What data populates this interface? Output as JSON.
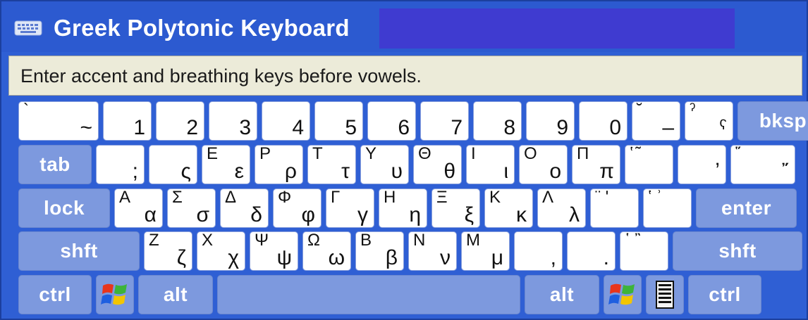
{
  "window": {
    "title": "Greek Polytonic Keyboard",
    "title_icon": "keyboard-icon"
  },
  "status": {
    "text": "Enter accent and breathing keys before vowels."
  },
  "rows": [
    [
      {
        "name": "key-grave",
        "type": "char",
        "up": "`",
        "lo": "~",
        "w": 114
      },
      {
        "name": "key-1",
        "type": "char",
        "up": "",
        "lo": "1",
        "w": 69
      },
      {
        "name": "key-2",
        "type": "char",
        "up": "",
        "lo": "2",
        "w": 69
      },
      {
        "name": "key-3",
        "type": "char",
        "up": "",
        "lo": "3",
        "w": 69
      },
      {
        "name": "key-4",
        "type": "char",
        "up": "",
        "lo": "4",
        "w": 69
      },
      {
        "name": "key-5",
        "type": "char",
        "up": "",
        "lo": "5",
        "w": 69
      },
      {
        "name": "key-6",
        "type": "char",
        "up": "",
        "lo": "6",
        "w": 69
      },
      {
        "name": "key-7",
        "type": "char",
        "up": "",
        "lo": "7",
        "w": 69
      },
      {
        "name": "key-8",
        "type": "char",
        "up": "",
        "lo": "8",
        "w": 69
      },
      {
        "name": "key-9",
        "type": "char",
        "up": "",
        "lo": "9",
        "w": 69
      },
      {
        "name": "key-0",
        "type": "char",
        "up": "",
        "lo": "0",
        "w": 69
      },
      {
        "name": "key-minus",
        "type": "char",
        "up": "˘",
        "lo": "–",
        "w": 69
      },
      {
        "name": "key-equals",
        "type": "char",
        "up": "ˀ",
        "lo": "ˁ",
        "w": 69
      },
      {
        "name": "key-backspace",
        "type": "fn",
        "label": "bksp",
        "w": 129
      }
    ],
    [
      {
        "name": "key-tab",
        "type": "fn",
        "label": "tab",
        "w": 104
      },
      {
        "name": "key-q",
        "type": "char",
        "up": "",
        "lo": ";",
        "w": 69
      },
      {
        "name": "key-w",
        "type": "char",
        "up": "",
        "lo": "ς",
        "w": 69
      },
      {
        "name": "key-e",
        "type": "char",
        "up": "Ε",
        "lo": "ε",
        "w": 69
      },
      {
        "name": "key-r",
        "type": "char",
        "up": "Ρ",
        "lo": "ρ",
        "w": 69
      },
      {
        "name": "key-t",
        "type": "char",
        "up": "Τ",
        "lo": "τ",
        "w": 69
      },
      {
        "name": "key-y",
        "type": "char",
        "up": "Υ",
        "lo": "υ",
        "w": 69
      },
      {
        "name": "key-u",
        "type": "char",
        "up": "Θ",
        "lo": "θ",
        "w": 69
      },
      {
        "name": "key-i",
        "type": "char",
        "up": "Ι",
        "lo": "ι",
        "w": 69
      },
      {
        "name": "key-o",
        "type": "char",
        "up": "Ο",
        "lo": "ο",
        "w": 69
      },
      {
        "name": "key-p",
        "type": "char",
        "up": "Π",
        "lo": "π",
        "w": 69
      },
      {
        "name": "key-lbracket",
        "type": "char",
        "up": "ʽ ͂",
        "lo": "",
        "w": 69
      },
      {
        "name": "key-rbracket",
        "type": "char",
        "up": "",
        "lo": "ʼ",
        "w": 69
      },
      {
        "name": "key-backslash",
        "type": "char",
        "up": "῞",
        "lo": "῎",
        "w": 92
      }
    ],
    [
      {
        "name": "key-caps-lock",
        "type": "fn",
        "label": "lock",
        "w": 130
      },
      {
        "name": "key-a",
        "type": "char",
        "up": "Α",
        "lo": "α",
        "w": 69
      },
      {
        "name": "key-s",
        "type": "char",
        "up": "Σ",
        "lo": "σ",
        "w": 69
      },
      {
        "name": "key-d",
        "type": "char",
        "up": "Δ",
        "lo": "δ",
        "w": 69
      },
      {
        "name": "key-f",
        "type": "char",
        "up": "Φ",
        "lo": "φ",
        "w": 69
      },
      {
        "name": "key-g",
        "type": "char",
        "up": "Γ",
        "lo": "γ",
        "w": 69
      },
      {
        "name": "key-h",
        "type": "char",
        "up": "Η",
        "lo": "η",
        "w": 69
      },
      {
        "name": "key-j",
        "type": "char",
        "up": "Ξ",
        "lo": "ξ",
        "w": 69
      },
      {
        "name": "key-k",
        "type": "char",
        "up": "Κ",
        "lo": "κ",
        "w": 69
      },
      {
        "name": "key-l",
        "type": "char",
        "up": "Λ",
        "lo": "λ",
        "w": 69
      },
      {
        "name": "key-semicolon",
        "type": "char",
        "up": "¨ ʹ",
        "lo": "",
        "w": 69
      },
      {
        "name": "key-quote",
        "type": "char",
        "up": "ʽ ʾ",
        "lo": "",
        "w": 69
      },
      {
        "name": "key-enter",
        "type": "fn",
        "label": "enter",
        "w": 143
      }
    ],
    [
      {
        "name": "key-shift-left",
        "type": "fn",
        "label": "shft",
        "w": 172
      },
      {
        "name": "key-z",
        "type": "char",
        "up": "Ζ",
        "lo": "ζ",
        "w": 69
      },
      {
        "name": "key-x",
        "type": "char",
        "up": "Χ",
        "lo": "χ",
        "w": 69
      },
      {
        "name": "key-c",
        "type": "char",
        "up": "Ψ",
        "lo": "ψ",
        "w": 69
      },
      {
        "name": "key-v",
        "type": "char",
        "up": "Ω",
        "lo": "ω",
        "w": 69
      },
      {
        "name": "key-b",
        "type": "char",
        "up": "Β",
        "lo": "β",
        "w": 69
      },
      {
        "name": "key-n",
        "type": "char",
        "up": "Ν",
        "lo": "ν",
        "w": 69
      },
      {
        "name": "key-m",
        "type": "char",
        "up": "Μ",
        "lo": "μ",
        "w": 69
      },
      {
        "name": "key-comma",
        "type": "char",
        "up": "",
        "lo": ",",
        "w": 69
      },
      {
        "name": "key-period",
        "type": "char",
        "up": "",
        "lo": ".",
        "w": 69
      },
      {
        "name": "key-slash",
        "type": "char",
        "up": "῾ ῍",
        "lo": "",
        "w": 69
      },
      {
        "name": "key-shift-right",
        "type": "fn",
        "label": "shft",
        "w": 184
      }
    ],
    [
      {
        "name": "key-ctrl-left",
        "type": "fn",
        "label": "ctrl",
        "w": 104
      },
      {
        "name": "key-windows-left",
        "type": "win",
        "w": 54
      },
      {
        "name": "key-alt-left",
        "type": "fn",
        "label": "alt",
        "w": 106
      },
      {
        "name": "key-space",
        "type": "space",
        "label": "",
        "w": 430
      },
      {
        "name": "key-alt-right",
        "type": "fn",
        "label": "alt",
        "w": 106
      },
      {
        "name": "key-windows-right",
        "type": "win",
        "w": 54
      },
      {
        "name": "key-menu",
        "type": "menu",
        "w": 54
      },
      {
        "name": "key-ctrl-right",
        "type": "fn",
        "label": "ctrl",
        "w": 104
      }
    ]
  ],
  "colors": {
    "window_blue": "#2f5fd4",
    "title_highlight": "#3f3bd0",
    "status_bg": "#ecebd9",
    "fn_key": "#7d99de",
    "char_key": "#ffffff"
  }
}
